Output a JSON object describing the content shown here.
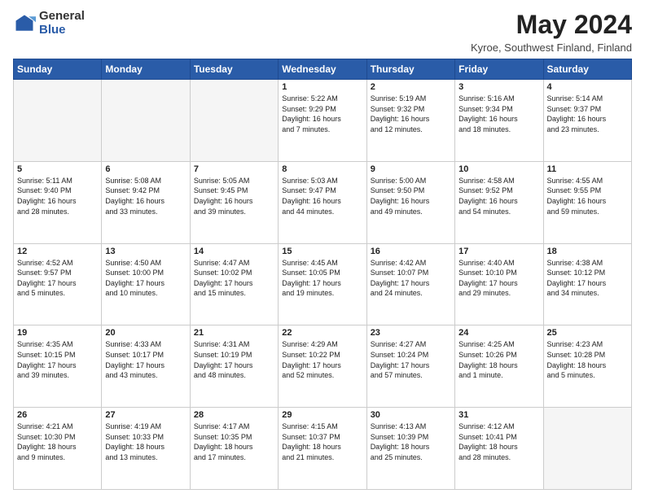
{
  "header": {
    "logo_general": "General",
    "logo_blue": "Blue",
    "title": "May 2024",
    "location": "Kyroe, Southwest Finland, Finland"
  },
  "weekdays": [
    "Sunday",
    "Monday",
    "Tuesday",
    "Wednesday",
    "Thursday",
    "Friday",
    "Saturday"
  ],
  "weeks": [
    [
      {
        "day": "",
        "info": ""
      },
      {
        "day": "",
        "info": ""
      },
      {
        "day": "",
        "info": ""
      },
      {
        "day": "1",
        "info": "Sunrise: 5:22 AM\nSunset: 9:29 PM\nDaylight: 16 hours\nand 7 minutes."
      },
      {
        "day": "2",
        "info": "Sunrise: 5:19 AM\nSunset: 9:32 PM\nDaylight: 16 hours\nand 12 minutes."
      },
      {
        "day": "3",
        "info": "Sunrise: 5:16 AM\nSunset: 9:34 PM\nDaylight: 16 hours\nand 18 minutes."
      },
      {
        "day": "4",
        "info": "Sunrise: 5:14 AM\nSunset: 9:37 PM\nDaylight: 16 hours\nand 23 minutes."
      }
    ],
    [
      {
        "day": "5",
        "info": "Sunrise: 5:11 AM\nSunset: 9:40 PM\nDaylight: 16 hours\nand 28 minutes."
      },
      {
        "day": "6",
        "info": "Sunrise: 5:08 AM\nSunset: 9:42 PM\nDaylight: 16 hours\nand 33 minutes."
      },
      {
        "day": "7",
        "info": "Sunrise: 5:05 AM\nSunset: 9:45 PM\nDaylight: 16 hours\nand 39 minutes."
      },
      {
        "day": "8",
        "info": "Sunrise: 5:03 AM\nSunset: 9:47 PM\nDaylight: 16 hours\nand 44 minutes."
      },
      {
        "day": "9",
        "info": "Sunrise: 5:00 AM\nSunset: 9:50 PM\nDaylight: 16 hours\nand 49 minutes."
      },
      {
        "day": "10",
        "info": "Sunrise: 4:58 AM\nSunset: 9:52 PM\nDaylight: 16 hours\nand 54 minutes."
      },
      {
        "day": "11",
        "info": "Sunrise: 4:55 AM\nSunset: 9:55 PM\nDaylight: 16 hours\nand 59 minutes."
      }
    ],
    [
      {
        "day": "12",
        "info": "Sunrise: 4:52 AM\nSunset: 9:57 PM\nDaylight: 17 hours\nand 5 minutes."
      },
      {
        "day": "13",
        "info": "Sunrise: 4:50 AM\nSunset: 10:00 PM\nDaylight: 17 hours\nand 10 minutes."
      },
      {
        "day": "14",
        "info": "Sunrise: 4:47 AM\nSunset: 10:02 PM\nDaylight: 17 hours\nand 15 minutes."
      },
      {
        "day": "15",
        "info": "Sunrise: 4:45 AM\nSunset: 10:05 PM\nDaylight: 17 hours\nand 19 minutes."
      },
      {
        "day": "16",
        "info": "Sunrise: 4:42 AM\nSunset: 10:07 PM\nDaylight: 17 hours\nand 24 minutes."
      },
      {
        "day": "17",
        "info": "Sunrise: 4:40 AM\nSunset: 10:10 PM\nDaylight: 17 hours\nand 29 minutes."
      },
      {
        "day": "18",
        "info": "Sunrise: 4:38 AM\nSunset: 10:12 PM\nDaylight: 17 hours\nand 34 minutes."
      }
    ],
    [
      {
        "day": "19",
        "info": "Sunrise: 4:35 AM\nSunset: 10:15 PM\nDaylight: 17 hours\nand 39 minutes."
      },
      {
        "day": "20",
        "info": "Sunrise: 4:33 AM\nSunset: 10:17 PM\nDaylight: 17 hours\nand 43 minutes."
      },
      {
        "day": "21",
        "info": "Sunrise: 4:31 AM\nSunset: 10:19 PM\nDaylight: 17 hours\nand 48 minutes."
      },
      {
        "day": "22",
        "info": "Sunrise: 4:29 AM\nSunset: 10:22 PM\nDaylight: 17 hours\nand 52 minutes."
      },
      {
        "day": "23",
        "info": "Sunrise: 4:27 AM\nSunset: 10:24 PM\nDaylight: 17 hours\nand 57 minutes."
      },
      {
        "day": "24",
        "info": "Sunrise: 4:25 AM\nSunset: 10:26 PM\nDaylight: 18 hours\nand 1 minute."
      },
      {
        "day": "25",
        "info": "Sunrise: 4:23 AM\nSunset: 10:28 PM\nDaylight: 18 hours\nand 5 minutes."
      }
    ],
    [
      {
        "day": "26",
        "info": "Sunrise: 4:21 AM\nSunset: 10:30 PM\nDaylight: 18 hours\nand 9 minutes."
      },
      {
        "day": "27",
        "info": "Sunrise: 4:19 AM\nSunset: 10:33 PM\nDaylight: 18 hours\nand 13 minutes."
      },
      {
        "day": "28",
        "info": "Sunrise: 4:17 AM\nSunset: 10:35 PM\nDaylight: 18 hours\nand 17 minutes."
      },
      {
        "day": "29",
        "info": "Sunrise: 4:15 AM\nSunset: 10:37 PM\nDaylight: 18 hours\nand 21 minutes."
      },
      {
        "day": "30",
        "info": "Sunrise: 4:13 AM\nSunset: 10:39 PM\nDaylight: 18 hours\nand 25 minutes."
      },
      {
        "day": "31",
        "info": "Sunrise: 4:12 AM\nSunset: 10:41 PM\nDaylight: 18 hours\nand 28 minutes."
      },
      {
        "day": "",
        "info": ""
      }
    ]
  ]
}
